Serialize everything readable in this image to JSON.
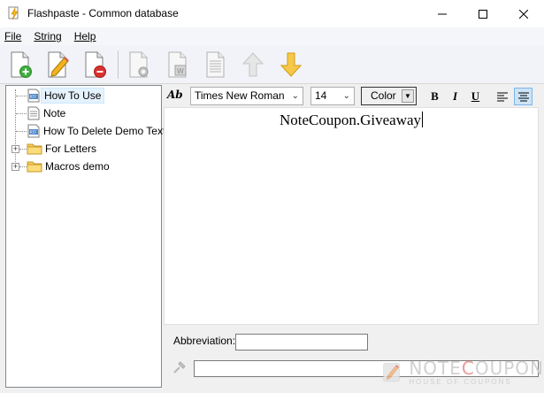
{
  "window": {
    "title": "Flashpaste - Common database"
  },
  "menu": [
    {
      "label": "File"
    },
    {
      "label": "String"
    },
    {
      "label": "Help"
    }
  ],
  "tree": {
    "items": [
      {
        "label": "How To Use",
        "icon": "rtf-doc-icon",
        "selected": true
      },
      {
        "label": "Note",
        "icon": "text-doc-icon"
      },
      {
        "label": "How To Delete Demo Text",
        "icon": "rtf-doc-icon"
      },
      {
        "label": "For Letters",
        "icon": "folder-icon"
      },
      {
        "label": "Macros demo",
        "icon": "folder-icon"
      }
    ]
  },
  "format": {
    "font": "Times New Roman",
    "size": "14",
    "color_label": "Color",
    "bold": "B",
    "italic": "I",
    "underline": "U"
  },
  "editor": {
    "text": "NoteCoupon.Giveaway"
  },
  "abbreviation": {
    "label": "Abbreviation:",
    "value": ""
  },
  "hotkey": {
    "value": ""
  },
  "watermark": {
    "name_a": "NOTE",
    "name_b": "C",
    "name_c": "OUPON",
    "tagline": "HOUSE OF COUPONS"
  },
  "colors": {
    "accent": "#f3b31f",
    "selection": "#e5f3ff",
    "new_green": "#3fae3f",
    "delete_red": "#d9322f"
  }
}
